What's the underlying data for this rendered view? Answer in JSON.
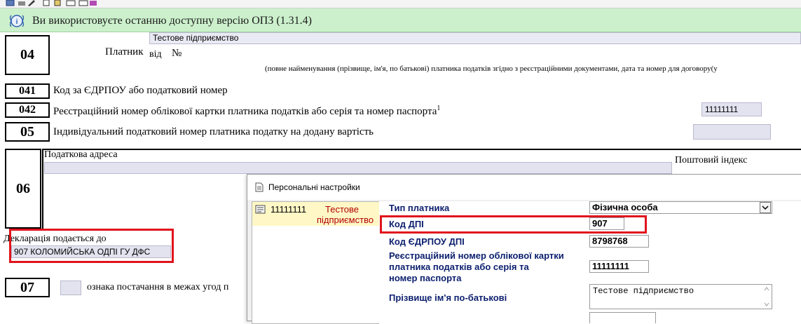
{
  "banner": {
    "text": "Ви використовуєте останню доступну версію ОПЗ (1.31.4)"
  },
  "form": {
    "s04": {
      "num": "04",
      "payer_label": "Платник",
      "from_label": "від",
      "number_label": "№",
      "payer_value": "Тестове підприємство",
      "note": "(повне найменування (прізвище, ім'я, по батькові) платника податків згідно з реєстраційними документами, дата та номер для договору(у"
    },
    "s041": {
      "num": "041",
      "label": "Код за ЄДРПОУ або податковий номер"
    },
    "s042": {
      "num": "042",
      "label": "Реєстраційний номер облікової картки платника податків або серія та номер паспорта",
      "sup": "1",
      "value": "11111111"
    },
    "s05": {
      "num": "05",
      "label": "Індивідуальний податковий номер платника податку на додану вартість",
      "value": ""
    },
    "s06": {
      "num": "06",
      "address_label": "Податкова адреса",
      "postal_label": "Поштовий індекс"
    },
    "declaration": {
      "label": "Декларація подається до",
      "value": "907 КОЛОМИЙСЬКА ОДПІ ГУ ДФС"
    },
    "s07": {
      "num": "07",
      "label": "ознака постачання в межах угод п"
    }
  },
  "dialog": {
    "title": "Персональні настройки",
    "payer": {
      "code": "11111111",
      "name_line1": "Тестове",
      "name_line2": "підприємство"
    },
    "fields": {
      "payer_type": {
        "label": "Тип платника",
        "value": "Фізична особа"
      },
      "dpi_code": {
        "label": "Код ДПІ",
        "value": "907"
      },
      "dpi_edrpou": {
        "label": "Код ЄДРПОУ ДПІ",
        "value": "8798768"
      },
      "reg_number": {
        "label_line1": "Реєстраційний номер облікової картки",
        "label_line2": "платника податків або серія та",
        "label_line3": "номер паспорта",
        "value": "11111111"
      },
      "full_name": {
        "label": "Прізвище ім'я по-батькові",
        "value": "Тестове підприємство"
      }
    }
  },
  "colors": {
    "banner_bg": "#ccf0cc",
    "field_bg": "#e3e3f0",
    "highlight_red": "#e0141c",
    "label_blue": "#0c1f6e",
    "selected_row": "#fff8c6"
  }
}
